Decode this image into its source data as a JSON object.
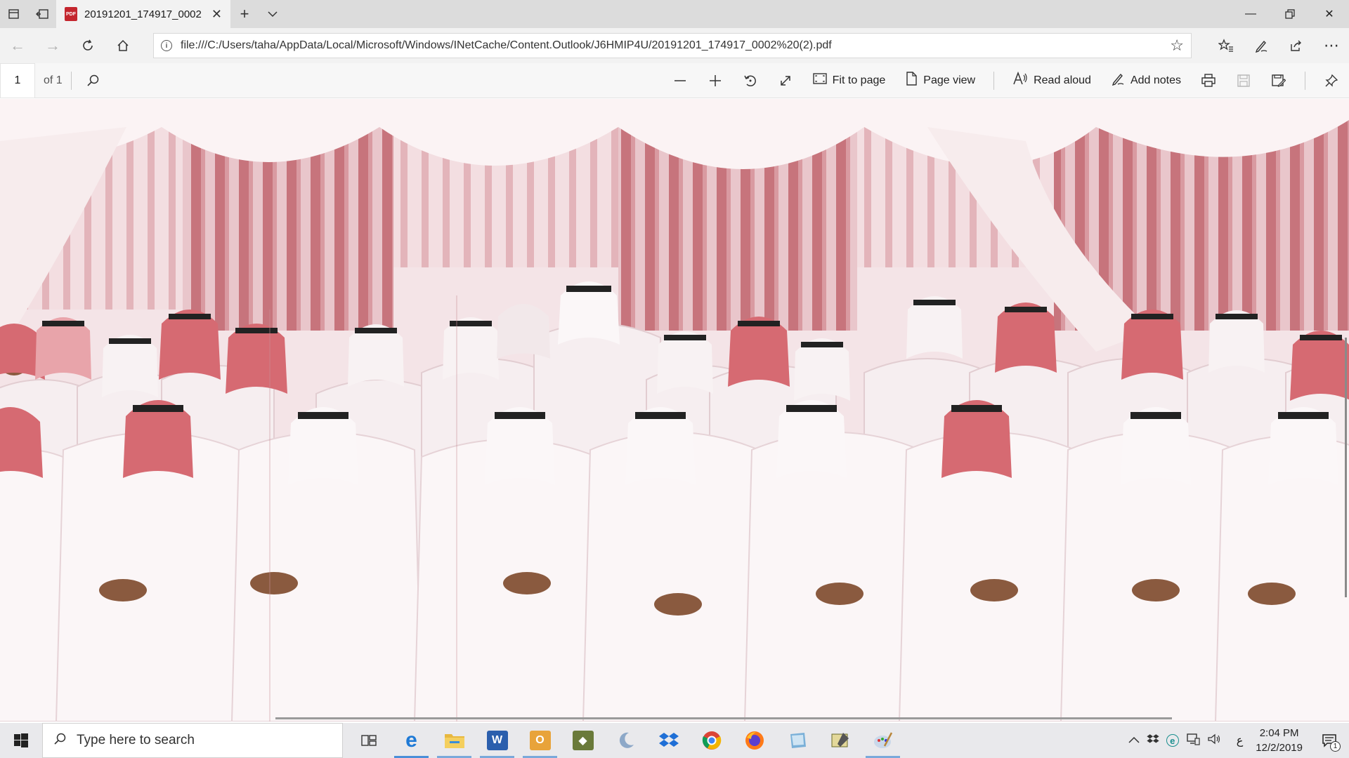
{
  "browser": {
    "tab": {
      "title": "20191201_174917_0002",
      "icon": "pdf-icon"
    },
    "address": {
      "url": "file:///C:/Users/taha/AppData/Local/Microsoft/Windows/INetCache/Content.Outlook/J6HMIP4U/20191201_174917_0002%20(2).pdf"
    }
  },
  "pdf_toolbar": {
    "page_current": "1",
    "page_total": "of 1",
    "fit_to_page": "Fit to page",
    "page_view": "Page view",
    "read_aloud": "Read aloud",
    "add_notes": "Add notes"
  },
  "taskbar": {
    "search_placeholder": "Type here to search",
    "time": "2:04 PM",
    "date": "12/2/2019",
    "language": "ع",
    "notification_count": "1"
  },
  "colors": {
    "accent": "#4a8fd8",
    "pdf_red": "#c4262e",
    "curtain_red": "#b5575f"
  }
}
